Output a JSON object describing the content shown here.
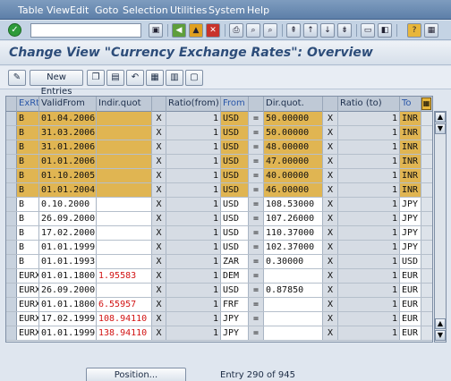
{
  "menu": {
    "items": [
      "Table View",
      "Edit",
      "Goto",
      "Selection",
      "Utilities",
      "System",
      "Help"
    ]
  },
  "toolbar": {
    "command_value": "",
    "icons": [
      "save-icon",
      "back-icon",
      "exit-icon",
      "cancel-icon",
      "print-icon",
      "find-icon",
      "find-next-icon",
      "first-page-icon",
      "prev-page-icon",
      "next-page-icon",
      "last-page-icon",
      "new-session-icon",
      "shortcut-icon",
      "help-icon",
      "layout-icon"
    ]
  },
  "title": "Change View \"Currency Exchange Rates\": Overview",
  "app_toolbar": {
    "new_entries_label": "New Entries"
  },
  "table": {
    "headers": [
      "ExRt",
      "ValidFrom",
      "Indir.quot",
      "",
      "Ratio(from)",
      "From",
      "",
      "Dir.quot.",
      "",
      "Ratio (to)",
      "To"
    ],
    "rows": [
      {
        "exrt": "B",
        "valid": "01.04.2006",
        "indir": "",
        "x1": "X",
        "ratio_from": "1",
        "from": "USD",
        "eq": "=",
        "dir": "50.00000",
        "x2": "X",
        "ratio_to": "1",
        "to": "INR",
        "hl": true
      },
      {
        "exrt": "B",
        "valid": "31.03.2006",
        "indir": "",
        "x1": "X",
        "ratio_from": "1",
        "from": "USD",
        "eq": "=",
        "dir": "50.00000",
        "x2": "X",
        "ratio_to": "1",
        "to": "INR",
        "hl": true
      },
      {
        "exrt": "B",
        "valid": "31.01.2006",
        "indir": "",
        "x1": "X",
        "ratio_from": "1",
        "from": "USD",
        "eq": "=",
        "dir": "48.00000",
        "x2": "X",
        "ratio_to": "1",
        "to": "INR",
        "hl": true
      },
      {
        "exrt": "B",
        "valid": "01.01.2006",
        "indir": "",
        "x1": "X",
        "ratio_from": "1",
        "from": "USD",
        "eq": "=",
        "dir": "47.00000",
        "x2": "X",
        "ratio_to": "1",
        "to": "INR",
        "hl": true
      },
      {
        "exrt": "B",
        "valid": "01.10.2005",
        "indir": "",
        "x1": "X",
        "ratio_from": "1",
        "from": "USD",
        "eq": "=",
        "dir": "40.00000",
        "x2": "X",
        "ratio_to": "1",
        "to": "INR",
        "hl": true
      },
      {
        "exrt": "B",
        "valid": "01.01.2004",
        "indir": "",
        "x1": "X",
        "ratio_from": "1",
        "from": "USD",
        "eq": "=",
        "dir": "46.00000",
        "x2": "X",
        "ratio_to": "1",
        "to": "INR",
        "hl": true
      },
      {
        "exrt": "B",
        "valid": "0.10.2000",
        "indir": "",
        "x1": "X",
        "ratio_from": "1",
        "from": "USD",
        "eq": "=",
        "dir": "108.53000",
        "x2": "X",
        "ratio_to": "1",
        "to": "JPY",
        "hl": false
      },
      {
        "exrt": "B",
        "valid": "26.09.2000",
        "indir": "",
        "x1": "X",
        "ratio_from": "1",
        "from": "USD",
        "eq": "=",
        "dir": "107.26000",
        "x2": "X",
        "ratio_to": "1",
        "to": "JPY",
        "hl": false
      },
      {
        "exrt": "B",
        "valid": "17.02.2000",
        "indir": "",
        "x1": "X",
        "ratio_from": "1",
        "from": "USD",
        "eq": "=",
        "dir": "110.37000",
        "x2": "X",
        "ratio_to": "1",
        "to": "JPY",
        "hl": false
      },
      {
        "exrt": "B",
        "valid": "01.01.1999",
        "indir": "",
        "x1": "X",
        "ratio_from": "1",
        "from": "USD",
        "eq": "=",
        "dir": "102.37000",
        "x2": "X",
        "ratio_to": "1",
        "to": "JPY",
        "hl": false
      },
      {
        "exrt": "B",
        "valid": "01.01.1993",
        "indir": "",
        "x1": "X",
        "ratio_from": "1",
        "from": "ZAR",
        "eq": "=",
        "dir": "0.30000",
        "x2": "X",
        "ratio_to": "1",
        "to": "USD",
        "hl": false
      },
      {
        "exrt": "EURX",
        "valid": "01.01.1800",
        "indir": "1.95583",
        "x1": "X",
        "ratio_from": "1",
        "from": "DEM",
        "eq": "=",
        "dir": "",
        "x2": "X",
        "ratio_to": "1",
        "to": "EUR",
        "hl": false
      },
      {
        "exrt": "EURX",
        "valid": "26.09.2000",
        "indir": "",
        "x1": "X",
        "ratio_from": "1",
        "from": "USD",
        "eq": "=",
        "dir": "0.87850",
        "x2": "X",
        "ratio_to": "1",
        "to": "EUR",
        "hl": false
      },
      {
        "exrt": "EURX",
        "valid": "01.01.1800",
        "indir": "6.55957",
        "x1": "X",
        "ratio_from": "1",
        "from": "FRF",
        "eq": "=",
        "dir": "",
        "x2": "X",
        "ratio_to": "1",
        "to": "EUR",
        "hl": false
      },
      {
        "exrt": "EURX",
        "valid": "17.02.1999",
        "indir": "108.94110",
        "x1": "X",
        "ratio_from": "1",
        "from": "JPY",
        "eq": "=",
        "dir": "",
        "x2": "X",
        "ratio_to": "1",
        "to": "EUR",
        "hl": false
      },
      {
        "exrt": "EURX",
        "valid": "01.01.1999",
        "indir": "138.94110",
        "x1": "X",
        "ratio_from": "1",
        "from": "JPY",
        "eq": "=",
        "dir": "",
        "x2": "X",
        "ratio_to": "1",
        "to": "EUR",
        "hl": false
      }
    ]
  },
  "footer": {
    "position_label": "Position...",
    "entry_info": "Entry 290 of 945"
  }
}
